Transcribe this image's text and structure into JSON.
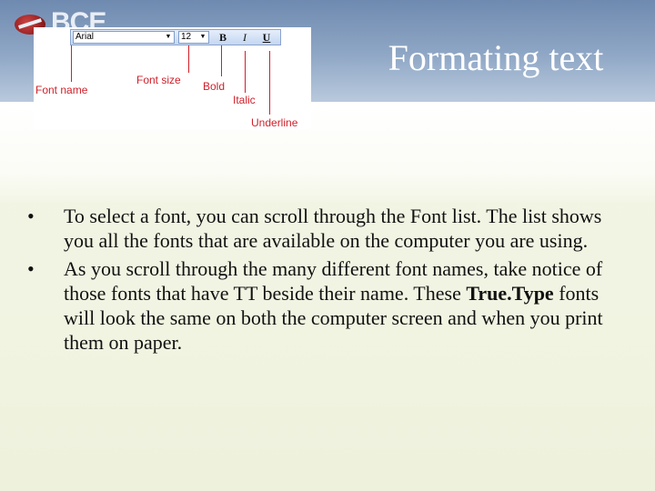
{
  "logo": {
    "text": "BCE"
  },
  "title": "Formating text",
  "figure": {
    "font_name_value": "Arial",
    "font_size_value": "12",
    "bold_glyph": "B",
    "italic_glyph": "I",
    "underline_glyph": "U",
    "callouts": {
      "font_name": "Font name",
      "font_size": "Font size",
      "bold": "Bold",
      "italic": "Italic",
      "underline": "Underline"
    }
  },
  "bullets": [
    {
      "text": "To select a font, you can scroll through the Font list. The list shows you all the fonts that are available on the computer you are using."
    },
    {
      "text_before": "As you scroll through the many different font names, take notice of those fonts that have TT beside their name. These ",
      "bold": "True.Type",
      "text_after": " fonts will look the same on both the computer screen and when you print them on paper."
    }
  ],
  "colors": {
    "callout": "#d0202a",
    "header": "#7f98ba",
    "background": "#f3f6e6"
  }
}
